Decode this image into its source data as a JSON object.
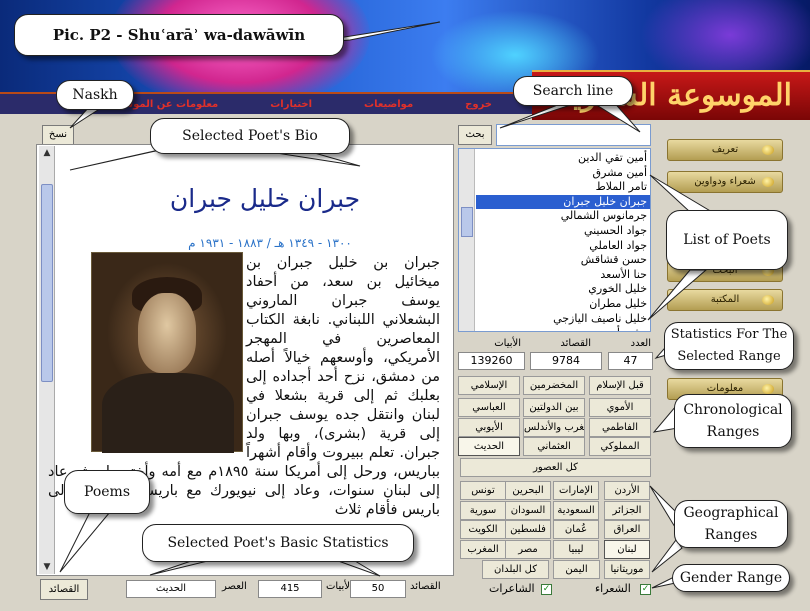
{
  "header": {
    "logo_text": "الموسوعة الشعرية"
  },
  "menu": [
    "خروج",
    "مواضيعات",
    "اختيارات",
    "معلومات عن الموسوعة"
  ],
  "search": {
    "button_label": "بحث",
    "input_value": ""
  },
  "naskh_button": "نسخ",
  "poet": {
    "name": "جبران خليل جبران",
    "dates": "١٣٠٠ - ١٣٤٩ هـ / ١٨٨٣ - ١٩٣١ م",
    "bio": "جبران بن خليل جبران بن ميخائيل بن سعد، من أحفاد يوسف جبران الماروني البشعلاني اللبناني. نابغة الكتاب المعاصرين في المهجر الأمريكي، وأوسعهم خيالاً أصله من دمشق، نزح أحد أجداده إلى بعلبك ثم إلى قرية بشعلا في لبنان وانتقل جده يوسف جبران إلى قرية (بشرى)، وبها ولد جبران. تعلم ببيروت وأقام أشهراً بباريس، ورحل إلى أمريكا سنة ١٨٩٥م مع أمه وأختين له، ثم عاد إلى لبنان سنوات، وعاد إلى نيويورك مع باريس، ثم ذهب إلى باريس فأقام ثلاث"
  },
  "poet_list": [
    "أمين تقي الدين",
    "أمين مشرق",
    "تامر الملاط",
    "جبران خليل جبران",
    "جرمانوس الشمالي",
    "جواد الحسيني",
    "جواد العاملي",
    "حسن قشاقش",
    "حنا الأسعد",
    "خليل الخوري",
    "خليل مطران",
    "خليل ناصيف اليازجي",
    "رشيد أيوب"
  ],
  "selected_poet_index": 3,
  "range_stats": {
    "labels": {
      "count": "العدد",
      "poems": "القصائد",
      "verses": "الأبيات"
    },
    "count": "47",
    "poems": "9784",
    "verses": "139260"
  },
  "chronological": [
    [
      "قبل الإسلام",
      "المخضرمين",
      "الإسلامي"
    ],
    [
      "الأموي",
      "بين الدولتين",
      "العباسي"
    ],
    [
      "الفاطمي",
      "المغرب والأندلس",
      "الأيوبي"
    ],
    [
      "المملوكي",
      "العثماني",
      "الحديث"
    ],
    [
      "كل العصور"
    ]
  ],
  "geographical": [
    [
      "الأردن",
      "الإمارات",
      "البحرين",
      "تونس"
    ],
    [
      "الجزائر",
      "السعودية",
      "السودان",
      "سورية"
    ],
    [
      "العراق",
      "عُمان",
      "فلسطين",
      "الكويت"
    ],
    [
      "لبنان",
      "ليبيا",
      "مصر",
      "المغرب"
    ],
    [
      "موريتانيا",
      "اليمن",
      "كل البلدان"
    ]
  ],
  "side_nav": [
    "تعريف",
    "شعراء ودواوين",
    "البحث",
    "المكتبة",
    "معلومات"
  ],
  "gender": {
    "male": "الشعراء",
    "female": "الشاعرات"
  },
  "bottom": {
    "poems_button": "القصائد",
    "era_label": "العصر",
    "era_value": "الحديث",
    "verses_label": "الأبيات",
    "verses_value": "415",
    "poems_label": "القصائد",
    "poems_value": "50"
  },
  "callouts": {
    "title": "Pic. P2 - Shuʿarāʾ wa-dawāwīn",
    "naskh": "Naskh",
    "bio": "Selected Poet's Bio",
    "search": "Search line",
    "list": "List of Poets",
    "stats": "Statistics For The Selected Range",
    "chrono": "Chronological Ranges",
    "geo": "Geographical Ranges",
    "gender": "Gender Range",
    "poems": "Poems",
    "basic": "Selected Poet's Basic Statistics"
  }
}
